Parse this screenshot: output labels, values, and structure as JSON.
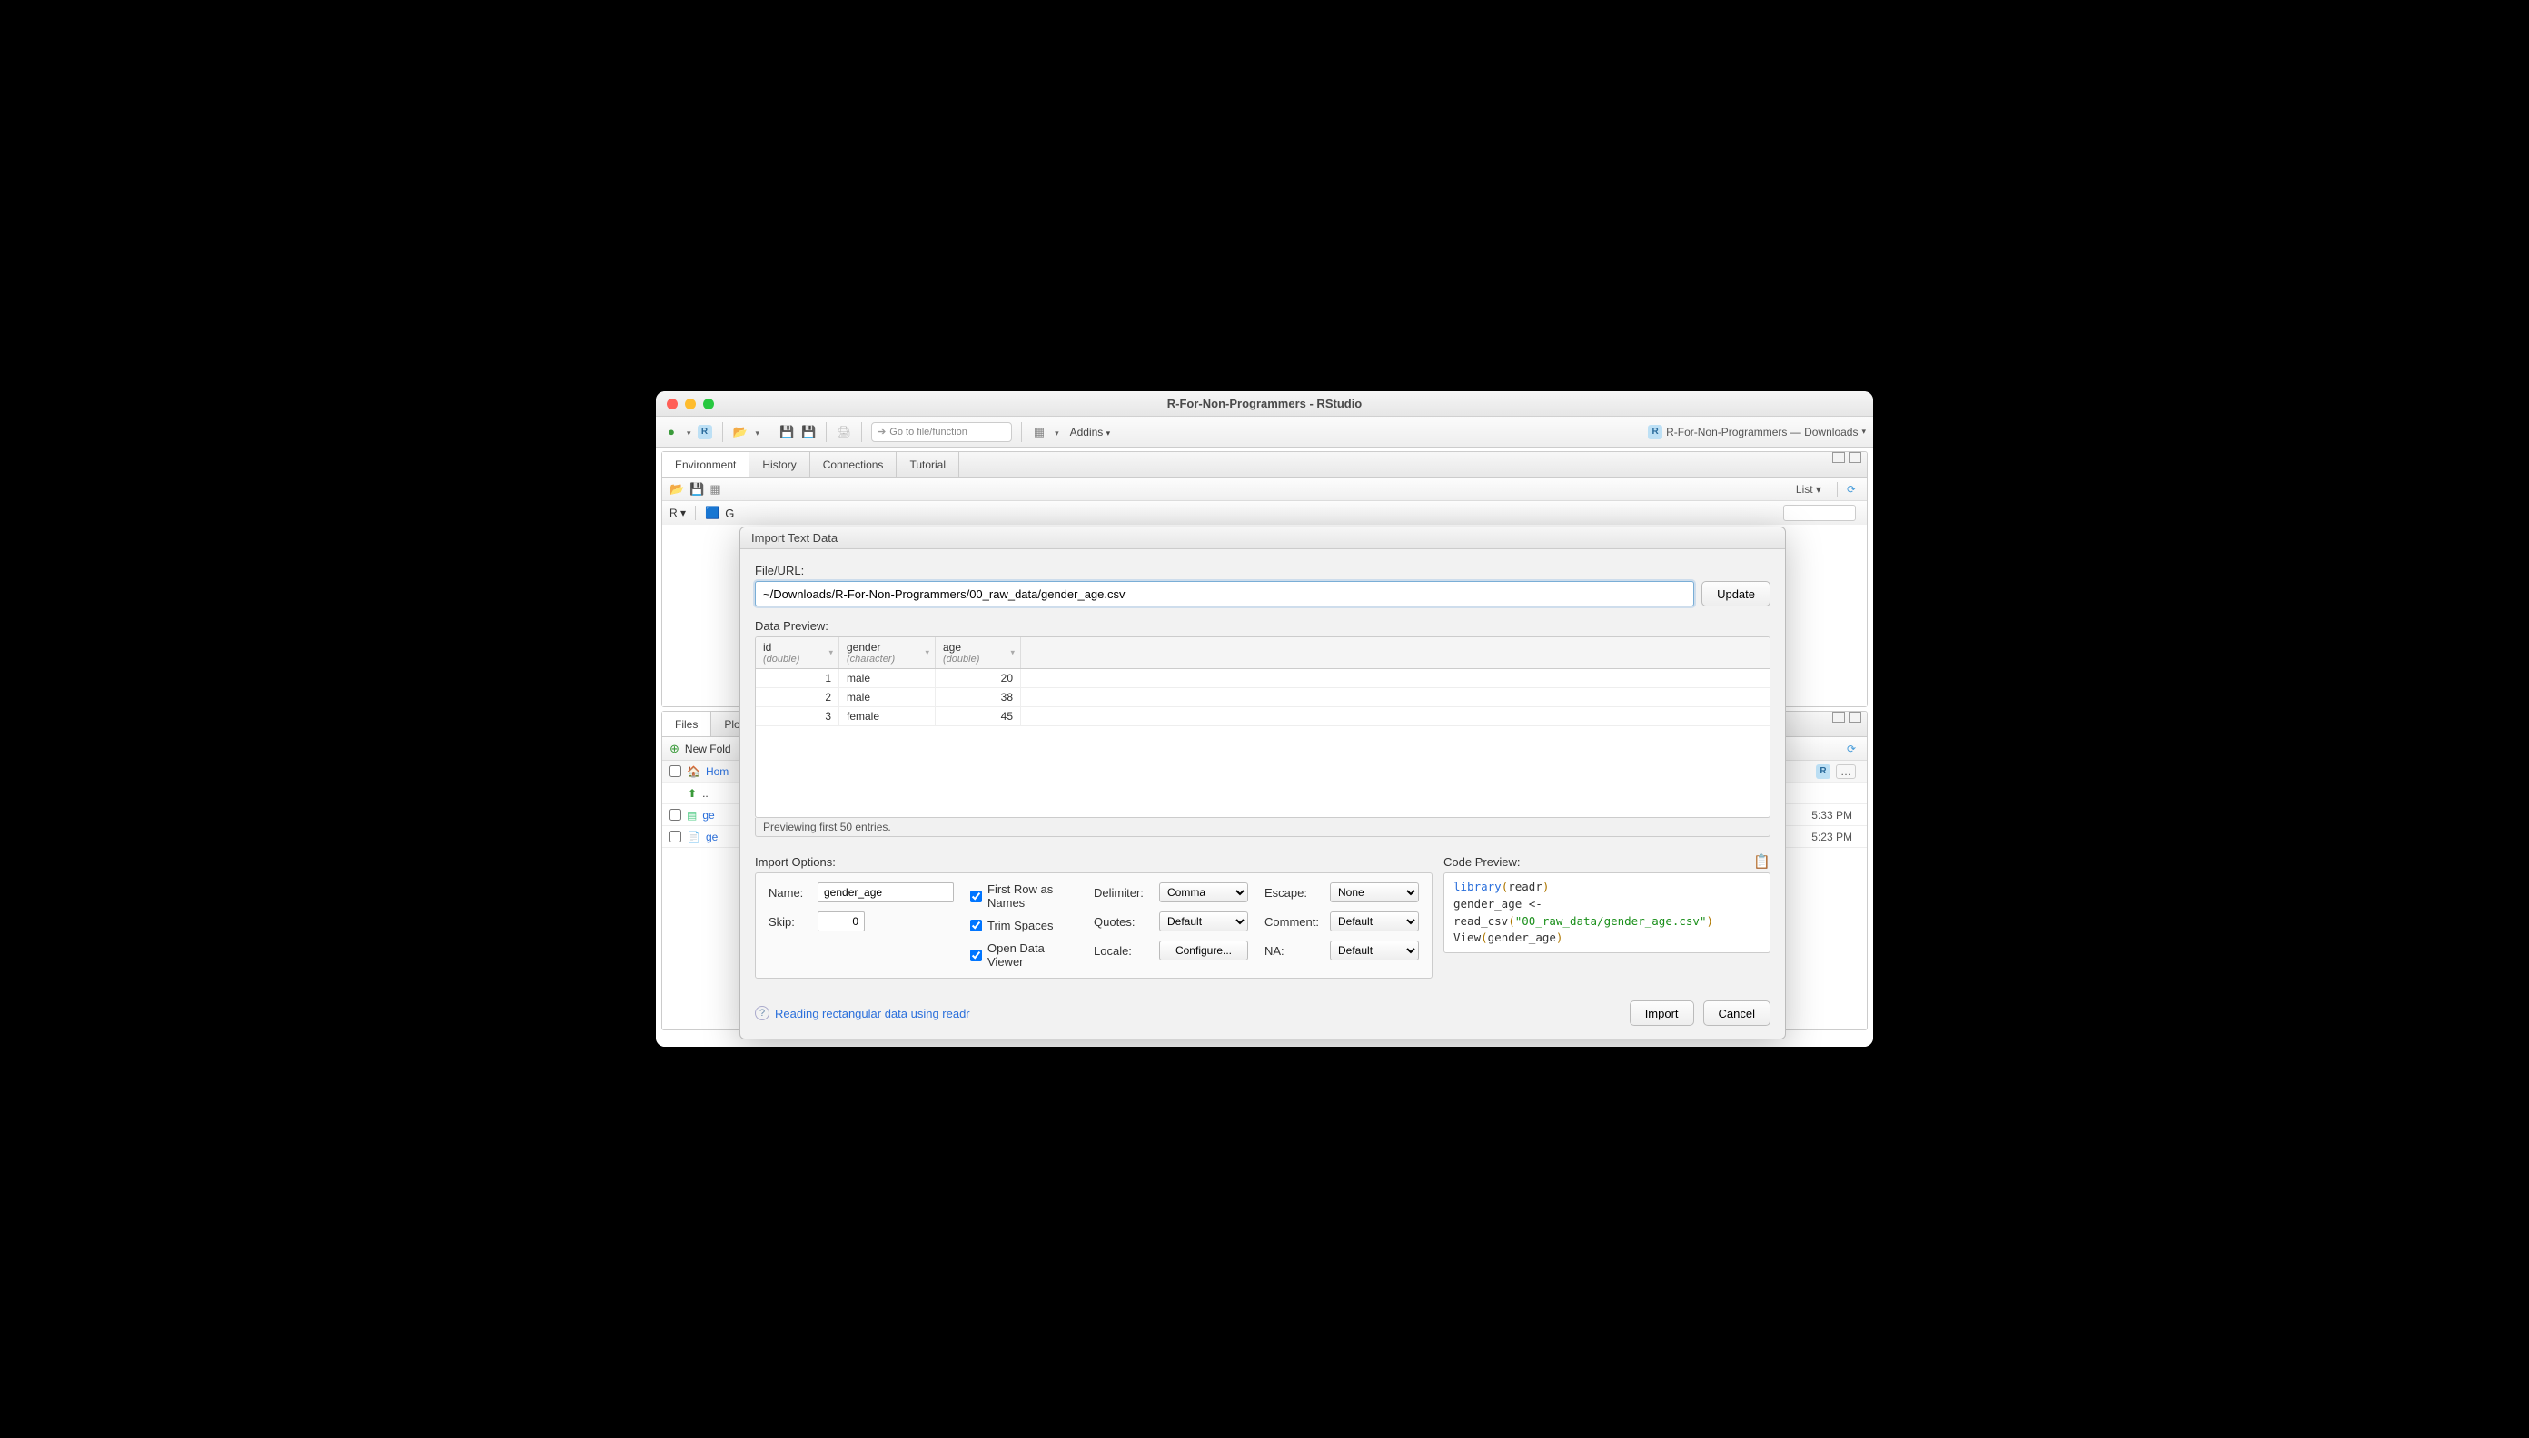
{
  "window": {
    "title": "R-For-Non-Programmers - RStudio"
  },
  "toolbar": {
    "goto_placeholder": "Go to file/function",
    "addins_label": "Addins",
    "project_label": "R-For-Non-Programmers — Downloads"
  },
  "env_pane": {
    "tabs": [
      "Environment",
      "History",
      "Connections",
      "Tutorial"
    ],
    "active": 0,
    "r_label": "R",
    "g_prefix": "G",
    "list_label": "List"
  },
  "files_pane": {
    "tabs": [
      "Files",
      "Plo"
    ],
    "newfolder_label": "New Fold",
    "home_label": "Hom",
    "dotdot": "..",
    "rows": [
      {
        "name": "ge",
        "time": "5:33 PM"
      },
      {
        "name": "ge",
        "time": "5:23 PM"
      }
    ]
  },
  "dialog": {
    "title": "Import Text Data",
    "file_label": "File/URL:",
    "file_value": "~/Downloads/R-For-Non-Programmers/00_raw_data/gender_age.csv",
    "update_label": "Update",
    "preview_label": "Data Preview:",
    "columns": [
      {
        "name": "id",
        "type": "(double)"
      },
      {
        "name": "gender",
        "type": "(character)"
      },
      {
        "name": "age",
        "type": "(double)"
      }
    ],
    "rows": [
      {
        "id": "1",
        "gender": "male",
        "age": "20"
      },
      {
        "id": "2",
        "gender": "male",
        "age": "38"
      },
      {
        "id": "3",
        "gender": "female",
        "age": "45"
      }
    ],
    "preview_status": "Previewing first 50 entries.",
    "options_label": "Import Options:",
    "name_label": "Name:",
    "name_value": "gender_age",
    "skip_label": "Skip:",
    "skip_value": "0",
    "chk_firstrow": "First Row as Names",
    "chk_trim": "Trim Spaces",
    "chk_viewer": "Open Data Viewer",
    "delimiter_label": "Delimiter:",
    "delimiter_value": "Comma",
    "quotes_label": "Quotes:",
    "quotes_value": "Default",
    "locale_label": "Locale:",
    "locale_btn": "Configure...",
    "escape_label": "Escape:",
    "escape_value": "None",
    "comment_label": "Comment:",
    "comment_value": "Default",
    "na_label": "NA:",
    "na_value": "Default",
    "code_label": "Code Preview:",
    "code": {
      "l1a": "library",
      "l1b": "(",
      "l1c": "readr",
      "l1d": ")",
      "l2a": "gender_age <- ",
      "l2b": "read_csv",
      "l2c": "(",
      "l2d": "\"00_raw_data/gender_age.csv\"",
      "l2e": ")",
      "l3a": "View",
      "l3b": "(",
      "l3c": "gender_age",
      "l3d": ")"
    },
    "help_label": "Reading rectangular data using readr",
    "import_label": "Import",
    "cancel_label": "Cancel"
  }
}
